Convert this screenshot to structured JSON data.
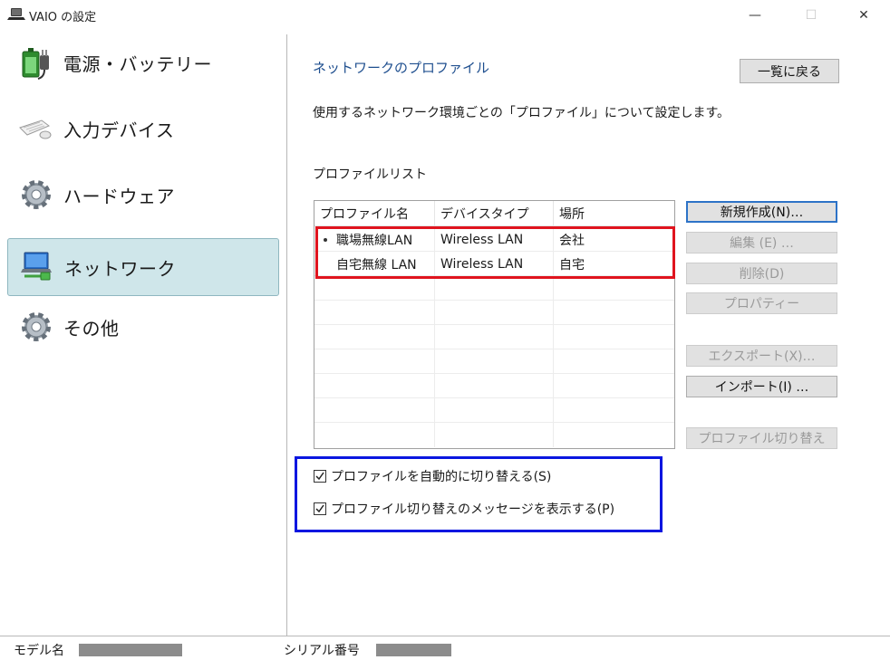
{
  "window": {
    "title": "VAIO の設定",
    "minimize_glyph": "—",
    "maximize_glyph": "☐",
    "close_glyph": "✕"
  },
  "sidebar": {
    "items": [
      {
        "label": "電源・バッテリー",
        "icon": "battery-plug-icon",
        "selected": false
      },
      {
        "label": "入力デバイス",
        "icon": "keyboard-mouse-icon",
        "selected": false
      },
      {
        "label": "ハードウェア",
        "icon": "gear-icon",
        "selected": false
      },
      {
        "label": "ネットワーク",
        "icon": "network-computer-icon",
        "selected": true
      },
      {
        "label": "その他",
        "icon": "gear-icon",
        "selected": false
      }
    ]
  },
  "main": {
    "title": "ネットワークのプロファイル",
    "back_button": "一覧に戻る",
    "description": "使用するネットワーク環境ごとの「プロファイル」について設定します。",
    "list_label": "プロファイルリスト",
    "table": {
      "columns": [
        "プロファイル名",
        "デバイスタイプ",
        "場所"
      ],
      "rows": [
        {
          "name": "職場無線LAN",
          "device": "Wireless LAN",
          "place": "会社",
          "active": true
        },
        {
          "name": "自宅無線 LAN",
          "device": "Wireless LAN",
          "place": "自宅",
          "active": false
        }
      ]
    },
    "buttons": {
      "new": "新規作成(N)…",
      "edit": "編集 (E) …",
      "delete": "削除(D)",
      "properties": "プロパティー",
      "export": "エクスポート(X)…",
      "import": "インポート(I) …",
      "switch": "プロファイル切り替え"
    },
    "checkboxes": {
      "auto_switch": {
        "label": "プロファイルを自動的に切り替える(S)",
        "checked": true
      },
      "show_message": {
        "label": "プロファイル切り替えのメッセージを表示する(P)",
        "checked": true
      }
    }
  },
  "status": {
    "model_label": "モデル名",
    "serial_label": "シリアル番号"
  },
  "colors": {
    "accent_title": "#1f4f8f",
    "selected_bg": "#cfe6ea",
    "red_highlight": "#e0141e",
    "blue_highlight": "#0a16e0",
    "default_button_border": "#2d73c7"
  }
}
